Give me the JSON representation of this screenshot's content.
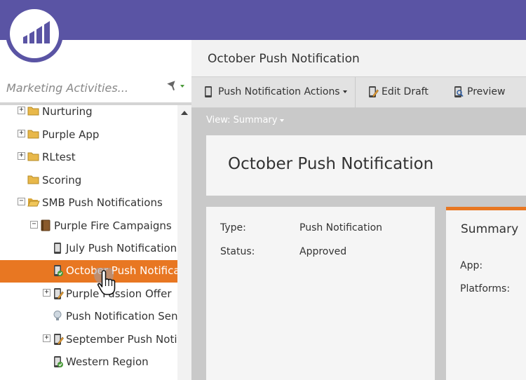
{
  "search": {
    "placeholder": "Marketing Activities..."
  },
  "tree": {
    "items": [
      {
        "label": "Nurturing",
        "icon": "folder-icon",
        "expander": "+"
      },
      {
        "label": "Purple App",
        "icon": "folder-icon",
        "expander": "+"
      },
      {
        "label": "RLtest",
        "icon": "folder-icon",
        "expander": "+"
      },
      {
        "label": "Scoring",
        "icon": "folder-icon",
        "expander": ""
      },
      {
        "label": "SMB Push Notifications",
        "icon": "folder-icon",
        "expander": "−"
      },
      {
        "label": "Purple Fire Campaigns",
        "icon": "program-icon",
        "expander": "−"
      },
      {
        "label": "July Push Notification",
        "icon": "mobile-icon",
        "expander": ""
      },
      {
        "label": "October Push Notification",
        "icon": "mobile-approved-icon",
        "expander": "",
        "selected": true
      },
      {
        "label": "Purple Passion Offer",
        "icon": "draft-icon",
        "expander": "+"
      },
      {
        "label": "Push Notification Sends",
        "icon": "lightbulb-icon",
        "expander": ""
      },
      {
        "label": "September Push Notification",
        "icon": "draft-icon",
        "expander": "+"
      },
      {
        "label": "Western Region",
        "icon": "mobile-approved-icon",
        "expander": ""
      }
    ]
  },
  "main": {
    "title": "October Push Notification",
    "toolbar": {
      "actions_label": "Push Notification Actions",
      "edit_label": "Edit Draft",
      "preview_label": "Preview"
    },
    "view_label": "View: Summary",
    "card_title": "October Push Notification",
    "details": {
      "type_label": "Type:",
      "type_value": "Push Notification",
      "status_label": "Status:",
      "status_value": "Approved"
    },
    "summary": {
      "heading": "Summary",
      "app_label": "App:",
      "platforms_label": "Platforms:"
    }
  },
  "colors": {
    "brand": "#5a54a4",
    "accent": "#e87722"
  }
}
